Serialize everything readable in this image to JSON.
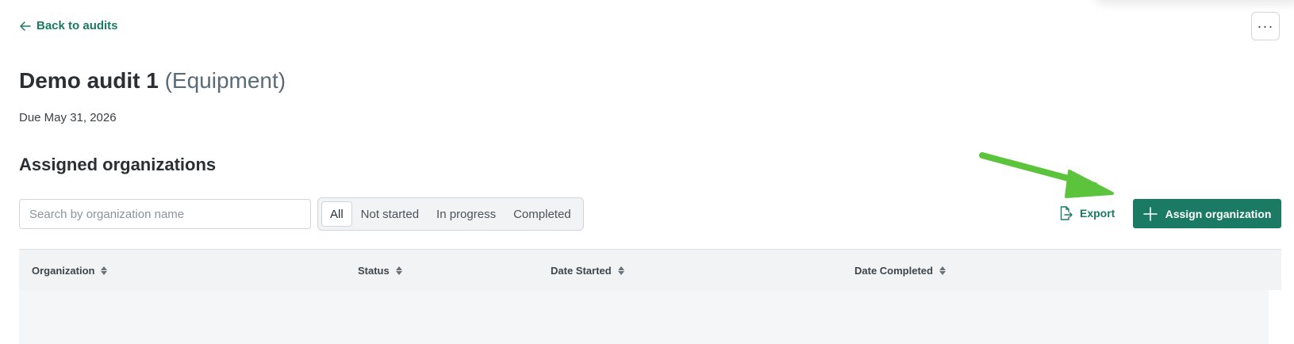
{
  "header": {
    "back_label": "Back to audits",
    "more_label": "···"
  },
  "audit": {
    "name": "Demo audit 1",
    "category": "(Equipment)",
    "due": "Due May 31, 2026"
  },
  "section": {
    "title": "Assigned organizations"
  },
  "search": {
    "placeholder": "Search by organization name",
    "value": ""
  },
  "filters": [
    {
      "label": "All",
      "active": true
    },
    {
      "label": "Not started",
      "active": false
    },
    {
      "label": "In progress",
      "active": false
    },
    {
      "label": "Completed",
      "active": false
    }
  ],
  "actions": {
    "export_label": "Export",
    "assign_label": "Assign organization"
  },
  "table": {
    "columns": [
      "Organization",
      "Status",
      "Date Started",
      "Date Completed"
    ],
    "rows": []
  },
  "colors": {
    "accent": "#1a7a63",
    "arrow": "#5cc43c"
  }
}
